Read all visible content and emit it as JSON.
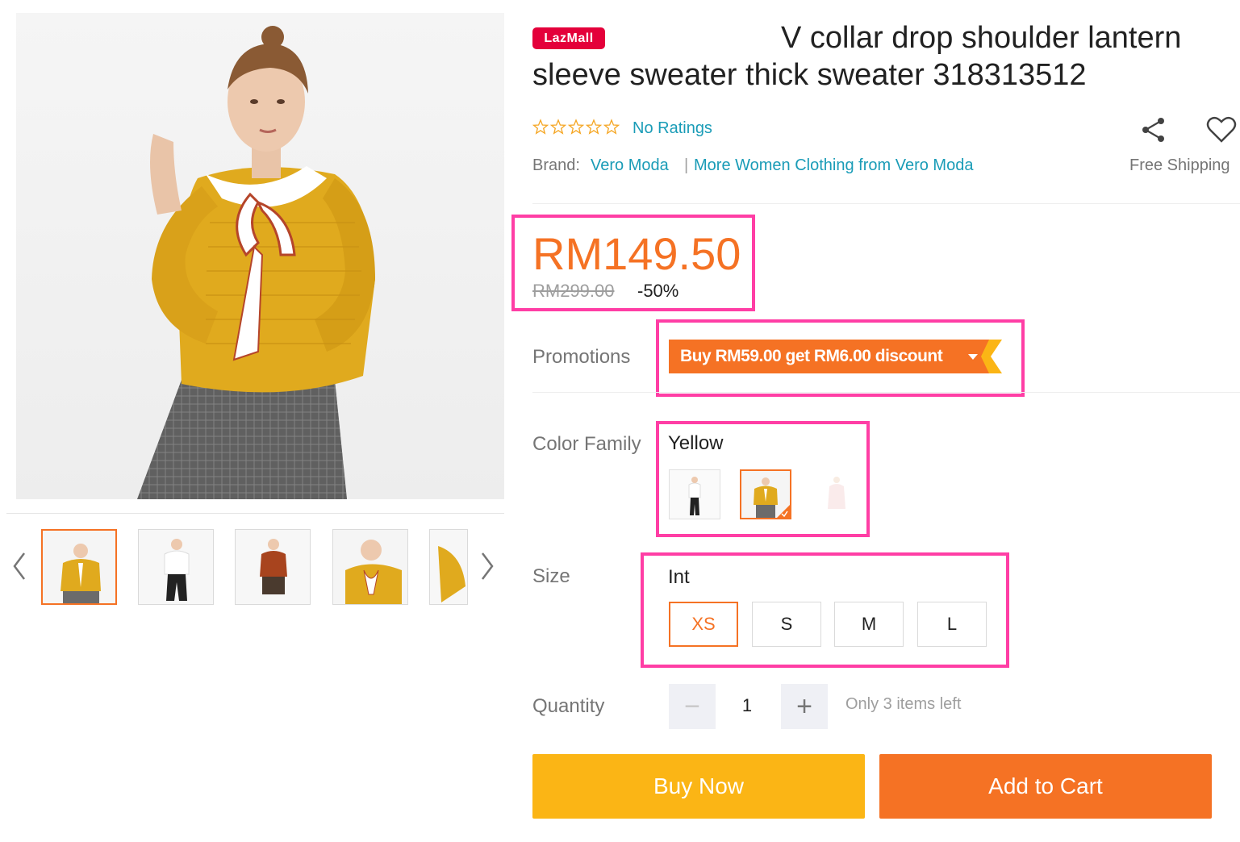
{
  "product": {
    "badge": "LazMall",
    "title_line1": "V collar drop shoulder lantern",
    "title_line2": "sleeve sweater thick sweater 318313512",
    "ratings_text": "No Ratings",
    "brand_label": "Brand:",
    "brand_name": "Vero Moda",
    "brand_separator": "|",
    "more_link": "More Women Clothing from Vero Moda",
    "free_shipping": "Free Shipping"
  },
  "price": {
    "current": "RM149.50",
    "original": "RM299.00",
    "discount": "-50%"
  },
  "promotions": {
    "label": "Promotions",
    "offer": "Buy RM59.00 get RM6.00 discount"
  },
  "color": {
    "label": "Color Family",
    "selected": "Yellow",
    "options_count": 3,
    "selected_index": 1
  },
  "size": {
    "label": "Size",
    "system": "Int",
    "options": [
      "XS",
      "S",
      "M",
      "L"
    ],
    "selected": "XS"
  },
  "quantity": {
    "label": "Quantity",
    "value": "1",
    "minus": "−",
    "plus": "+",
    "stock_note": "Only 3 items left"
  },
  "actions": {
    "buy_now": "Buy Now",
    "add_to_cart": "Add to Cart"
  },
  "icons": [
    "chevron-left-icon",
    "chevron-right-icon",
    "share-icon",
    "heart-icon",
    "star-icon",
    "chevron-down-icon"
  ],
  "colors": {
    "accent": "#f57224",
    "buy_now": "#fbb515",
    "link": "#1a9cb7",
    "lazmall": "#e4003a",
    "highlight_box": "#ff3ea5",
    "sweater_yellow": "#e0aa1e"
  }
}
